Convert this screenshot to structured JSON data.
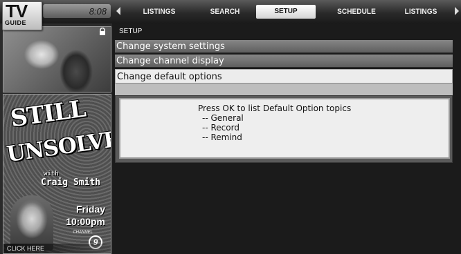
{
  "header": {
    "logo_top": "TV",
    "logo_bottom": "GUIDE",
    "clock": "8:08",
    "tabs": [
      {
        "label": "LISTINGS"
      },
      {
        "label": "SEARCH"
      },
      {
        "label": "SETUP",
        "selected": true
      },
      {
        "label": "SCHEDULE"
      },
      {
        "label": "LISTINGS"
      }
    ]
  },
  "promo": {
    "line1": "STILL",
    "line2": "UNSOLVED",
    "with": "with",
    "host": "Craig Smith",
    "day": "Friday",
    "time": "10:00pm",
    "channel_label": "CHANNEL",
    "channel_number": "9",
    "cta": "CLICK HERE"
  },
  "setup": {
    "breadcrumb": "SETUP",
    "menu": [
      {
        "label": "Change system settings"
      },
      {
        "label": "Change channel display"
      },
      {
        "label": "Change default options",
        "selected": true
      }
    ],
    "info": {
      "prompt": "Press OK to list Default Option topics",
      "options": [
        "-- General",
        "-- Record",
        "-- Remind"
      ]
    }
  },
  "colors": {
    "background": "#1b1b1b",
    "menu_item": "#747474",
    "menu_selected": "#ececec",
    "info_box": "#eeeeee"
  }
}
